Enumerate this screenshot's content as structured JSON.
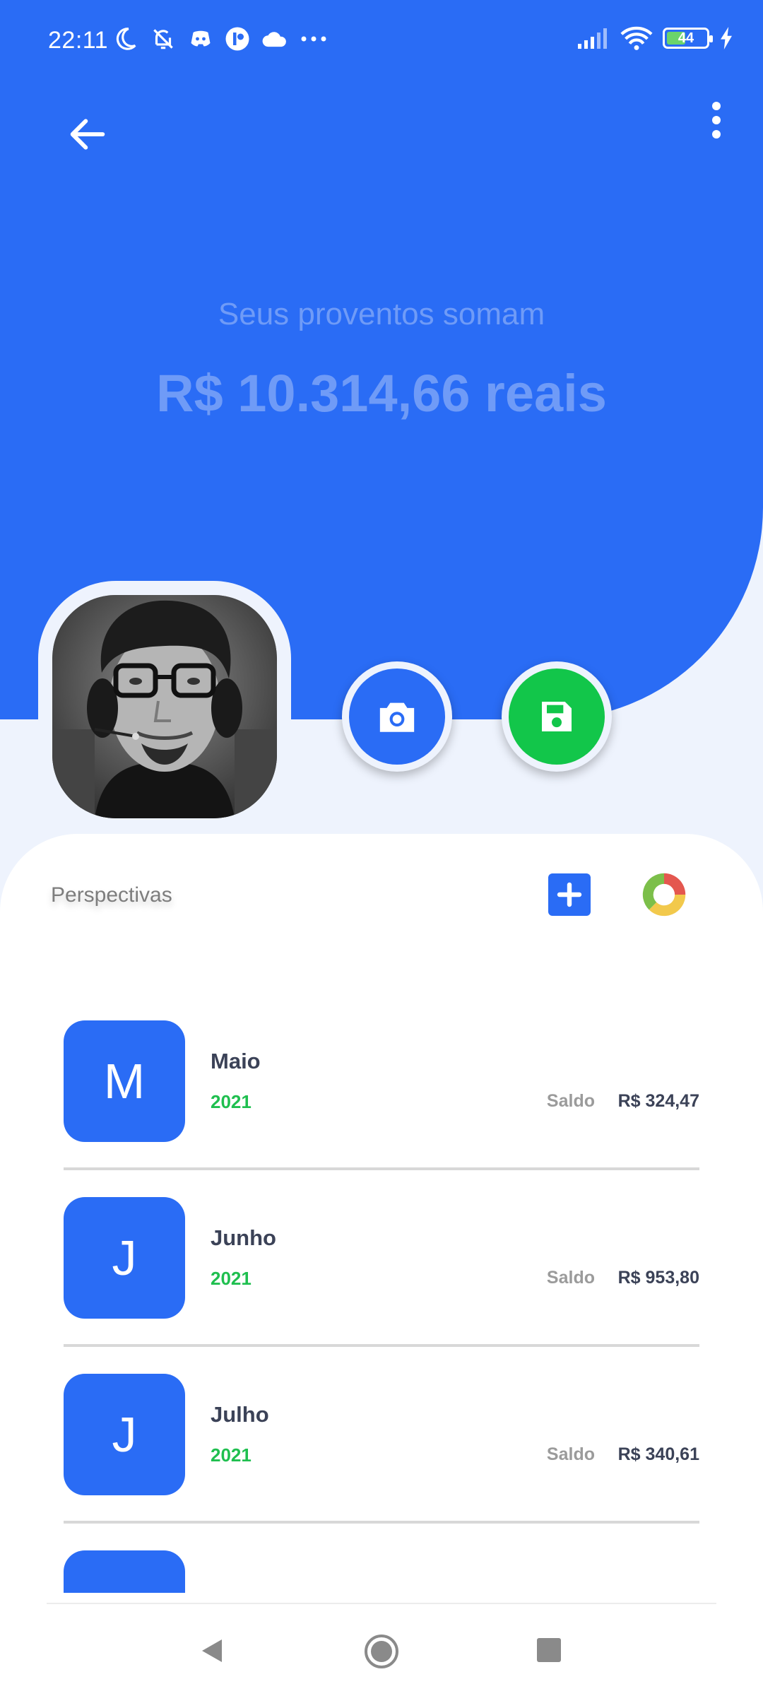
{
  "status_bar": {
    "time": "22:11",
    "battery": "44",
    "left_icons": [
      "moon-icon",
      "bell-off-icon",
      "discord-icon",
      "app-icon",
      "cloud-icon",
      "more-dots-icon"
    ],
    "right_icons": [
      "signal-icon",
      "wifi-icon",
      "battery-icon",
      "charging-icon"
    ]
  },
  "header": {
    "back_icon": "arrow-left-icon",
    "menu_icon": "more-vertical-icon",
    "total_label": "Seus proventos somam",
    "total_value": "R$ 10.314,66 reais"
  },
  "actions": {
    "camera_icon": "camera-icon",
    "save_icon": "floppy-disk-icon",
    "camera_color": "#2a6cf5",
    "save_color": "#12c64a"
  },
  "section": {
    "title": "Perspectivas",
    "add_icon": "plus-icon",
    "chart_icon": "donut-chart-icon"
  },
  "months": [
    {
      "letter": "M",
      "name": "Maio",
      "year": "2021",
      "saldo_label": "Saldo",
      "saldo": "R$ 324,47"
    },
    {
      "letter": "J",
      "name": "Junho",
      "year": "2021",
      "saldo_label": "Saldo",
      "saldo": "R$ 953,80"
    },
    {
      "letter": "J",
      "name": "Julho",
      "year": "2021",
      "saldo_label": "Saldo",
      "saldo": "R$ 340,61"
    }
  ],
  "nav": {
    "back": "nav-back-icon",
    "home": "nav-home-icon",
    "recents": "nav-recents-icon"
  },
  "colors": {
    "primary": "#2a6cf5",
    "accent_green": "#1fbf4f",
    "background": "#eef3fd"
  }
}
